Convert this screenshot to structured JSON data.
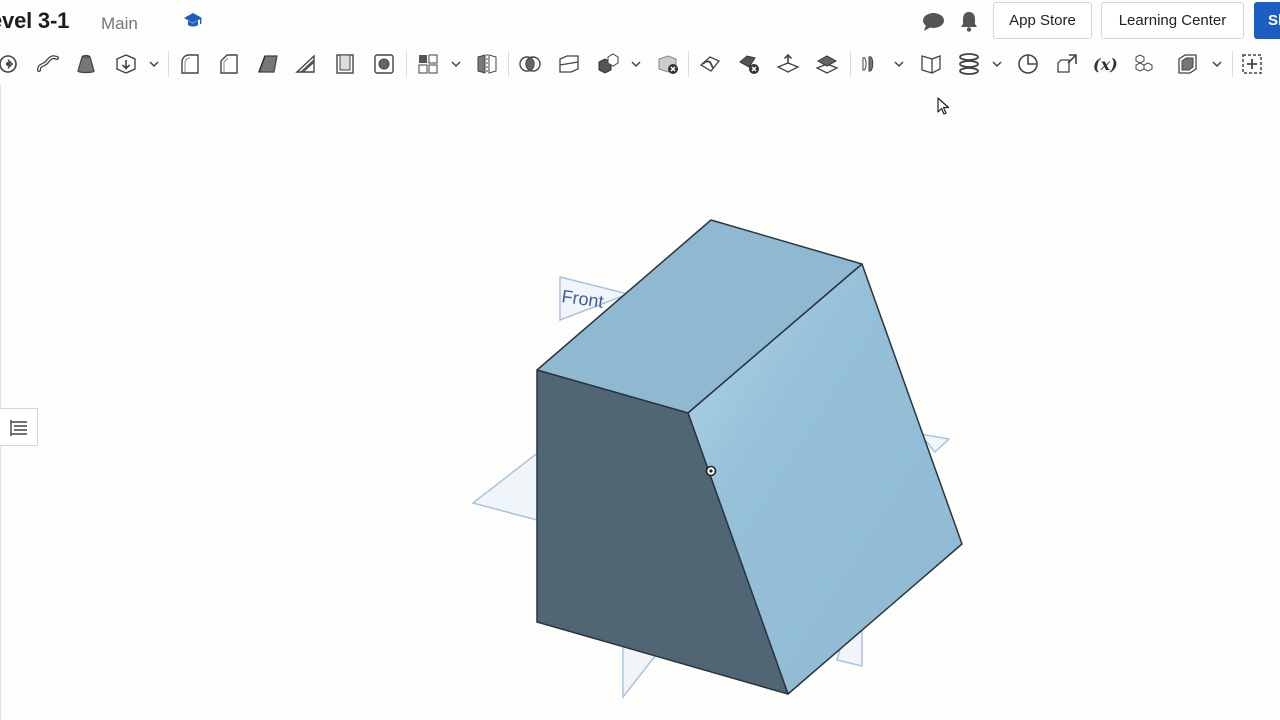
{
  "document": {
    "title": "evel 3-1",
    "branch": "Main"
  },
  "header": {
    "app_store_label": "App Store",
    "learning_center_label": "Learning Center",
    "share_label": "Sh"
  },
  "viewport": {
    "plane_label": "Front",
    "part_colors": {
      "top": "#8fb8d1",
      "right": "#93bfd8",
      "front": "#506674"
    }
  },
  "colors": {
    "accent": "#1c5fc4",
    "learn_icon": "#1c5fc4"
  }
}
